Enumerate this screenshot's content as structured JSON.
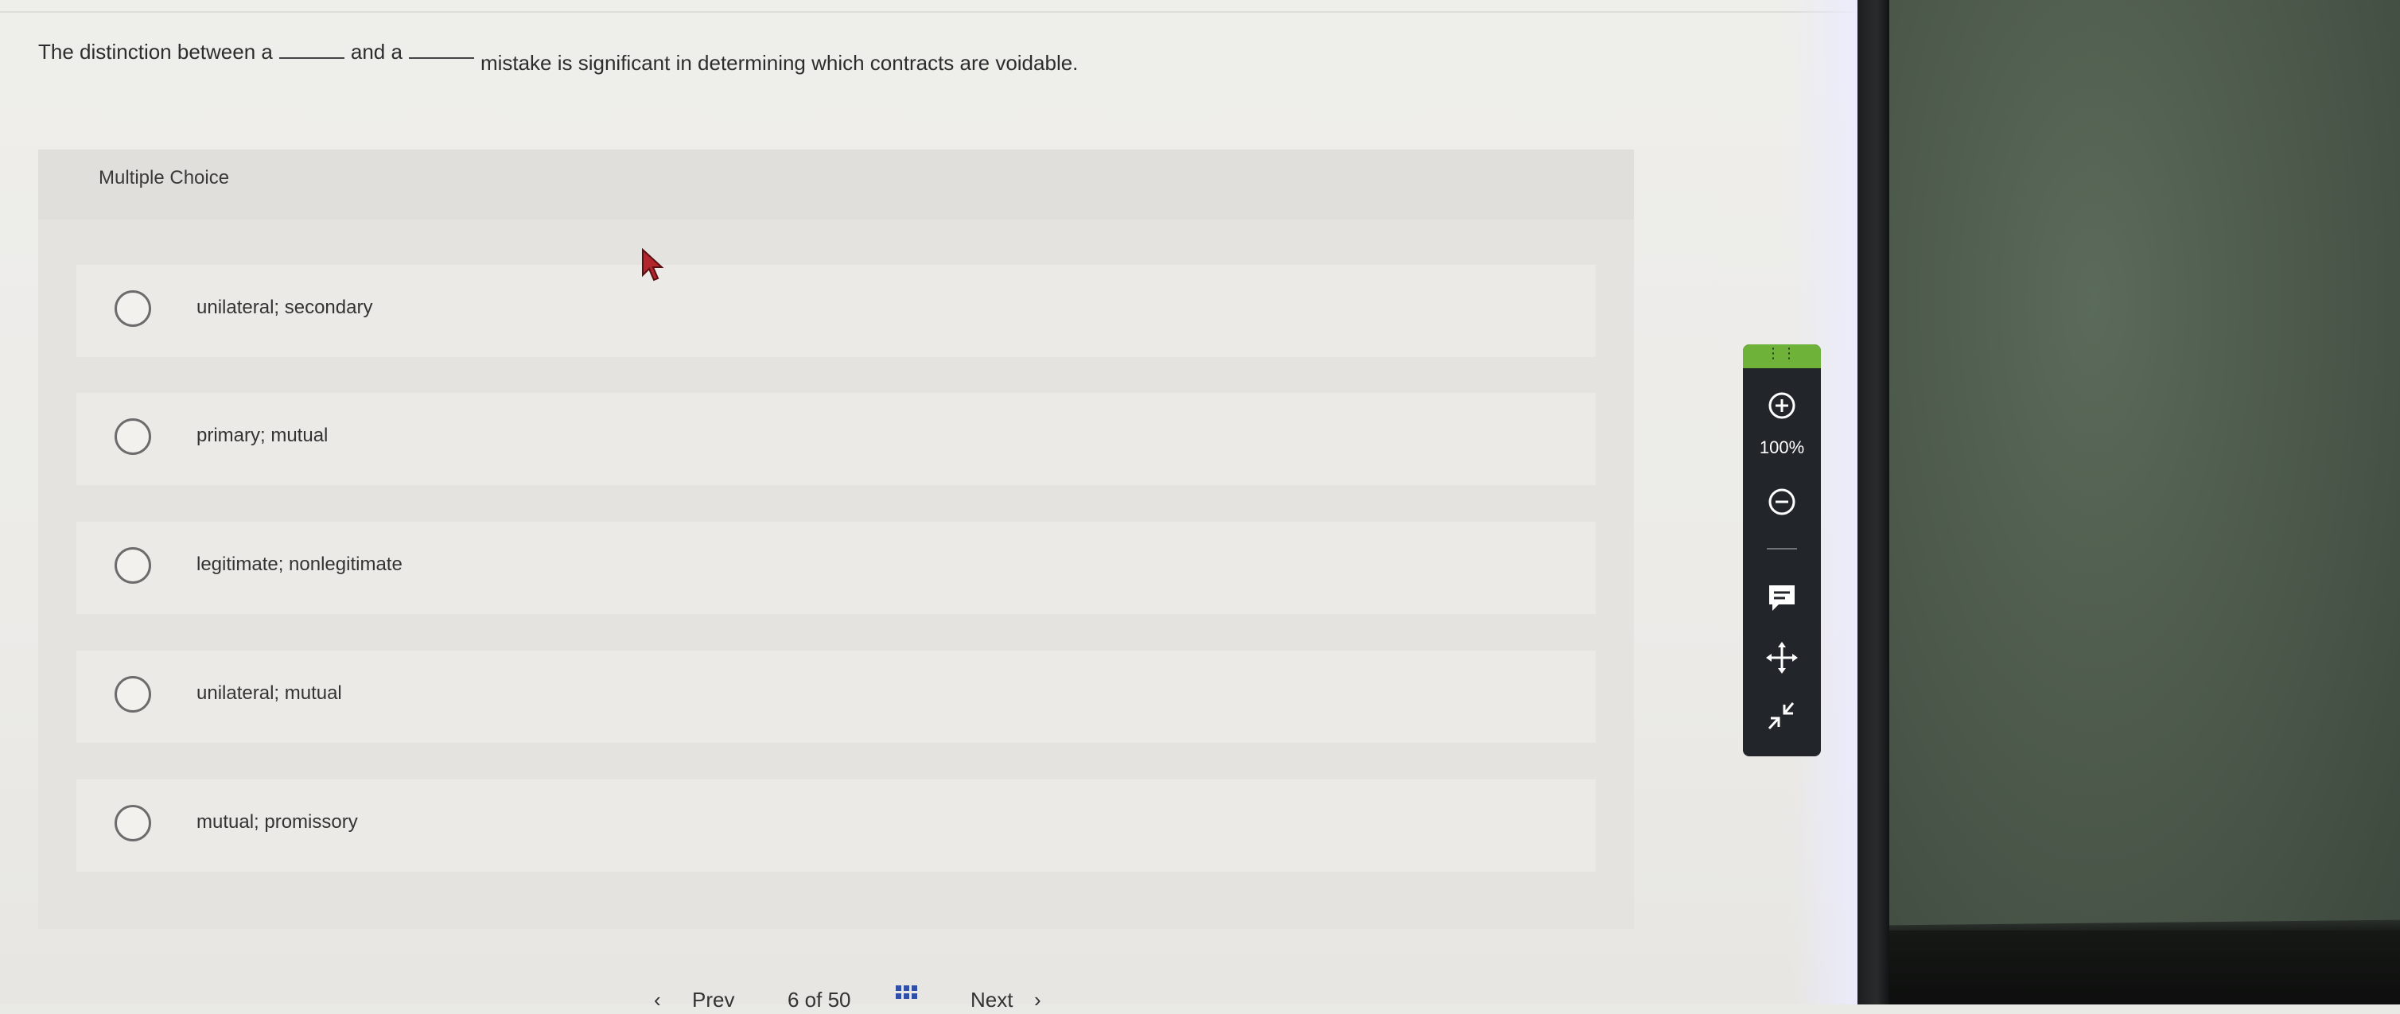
{
  "question": {
    "part1": "The distinction between a",
    "part2": "and a",
    "part3": "mistake is significant in determining which contracts are voidable."
  },
  "panel": {
    "title": "Multiple Choice",
    "options": [
      {
        "label": "unilateral; secondary",
        "selected": false
      },
      {
        "label": "primary; mutual",
        "selected": false
      },
      {
        "label": "legitimate; nonlegitimate",
        "selected": false
      },
      {
        "label": "unilateral; mutual",
        "selected": false
      },
      {
        "label": "mutual; promissory",
        "selected": false
      }
    ]
  },
  "zoom_toolbar": {
    "level": "100%",
    "grip_color": "#6fb23a",
    "icons": [
      "plus-circle-icon",
      "minus-circle-icon",
      "comment-icon",
      "move-icon",
      "collapse-icon"
    ]
  },
  "bottom_nav": {
    "prev_label": "Prev",
    "page_text": "6 of 50",
    "next_label": "Next"
  }
}
